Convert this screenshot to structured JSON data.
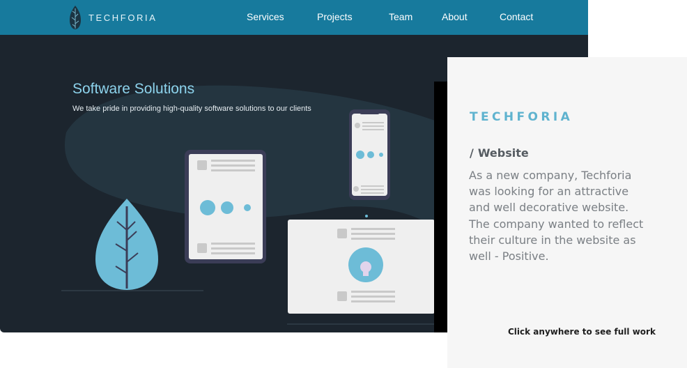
{
  "site": {
    "brand": "TECHFORIA",
    "nav": [
      {
        "label": "Services"
      },
      {
        "label": "Projects"
      },
      {
        "label": "Team"
      },
      {
        "label": "About"
      },
      {
        "label": "Contact"
      }
    ],
    "hero": {
      "title": "Software Solutions",
      "subtitle": "We take pride in providing high-quality software solutions to our clients"
    },
    "icons": {
      "brand": "leaf-logo-icon",
      "plant": "leaf-illustration-icon",
      "avatar": "person-avatar-icon"
    }
  },
  "project": {
    "brand": "TECHFORIA",
    "category_slash": "/",
    "category": "Website",
    "description": "As a new company, Techforia was looking for an attractive and well decorative website. The company wanted to reflect their culture in the website as well - Positive.",
    "cta": "Click anywhere to see full work"
  },
  "colors": {
    "nav_bg": "#177a9d",
    "hero_bg": "#1c252e",
    "accent": "#6dbcd7",
    "card_bg": "#f6f6f6",
    "brand_text": "#5fb3cf"
  }
}
